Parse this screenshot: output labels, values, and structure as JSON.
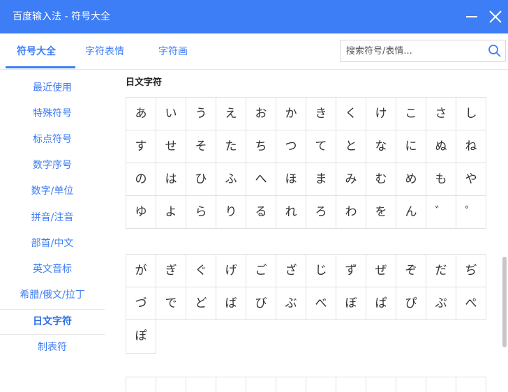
{
  "window": {
    "title": "百度输入法 - 符号大全",
    "minimize_icon": "minimize-icon",
    "close_icon": "close-icon"
  },
  "tabs": [
    {
      "label": "符号大全",
      "active": true
    },
    {
      "label": "字符表情",
      "active": false
    },
    {
      "label": "字符画",
      "active": false
    }
  ],
  "search": {
    "placeholder": "搜索符号/表情...",
    "value": "",
    "icon": "search-icon"
  },
  "sidebar": {
    "items": [
      {
        "label": "最近使用",
        "active": false
      },
      {
        "label": "特殊符号",
        "active": false
      },
      {
        "label": "标点符号",
        "active": false
      },
      {
        "label": "数字序号",
        "active": false
      },
      {
        "label": "数字/单位",
        "active": false
      },
      {
        "label": "拼音/注音",
        "active": false
      },
      {
        "label": "部首/中文",
        "active": false
      },
      {
        "label": "英文音标",
        "active": false
      },
      {
        "label": "希腊/俄文/拉丁",
        "active": false
      },
      {
        "label": "日文字符",
        "active": true
      },
      {
        "label": "制表符",
        "active": false
      }
    ]
  },
  "content": {
    "section_title": "日文字符",
    "hiragana": [
      "あ",
      "い",
      "う",
      "え",
      "お",
      "か",
      "き",
      "く",
      "け",
      "こ",
      "さ",
      "し",
      "す",
      "せ",
      "そ",
      "た",
      "ち",
      "つ",
      "て",
      "と",
      "な",
      "に",
      "ぬ",
      "ね",
      "の",
      "は",
      "ひ",
      "ふ",
      "へ",
      "ほ",
      "ま",
      "み",
      "む",
      "め",
      "も",
      "や",
      "ゆ",
      "よ",
      "ら",
      "り",
      "る",
      "れ",
      "ろ",
      "わ",
      "を",
      "ん",
      "゛",
      "゜"
    ],
    "dakuon": [
      "が",
      "ぎ",
      "ぐ",
      "げ",
      "ご",
      "ざ",
      "じ",
      "ず",
      "ぜ",
      "ぞ",
      "だ",
      "ぢ",
      "づ",
      "で",
      "ど",
      "ば",
      "び",
      "ぶ",
      "べ",
      "ぼ",
      "ぱ",
      "ぴ",
      "ぷ",
      "ぺ"
    ],
    "dakuon_extra": "ぽ"
  },
  "colors": {
    "accent": "#3d7df6",
    "titlebar": "#3d7df6",
    "grid_border": "#e0e0e0"
  }
}
